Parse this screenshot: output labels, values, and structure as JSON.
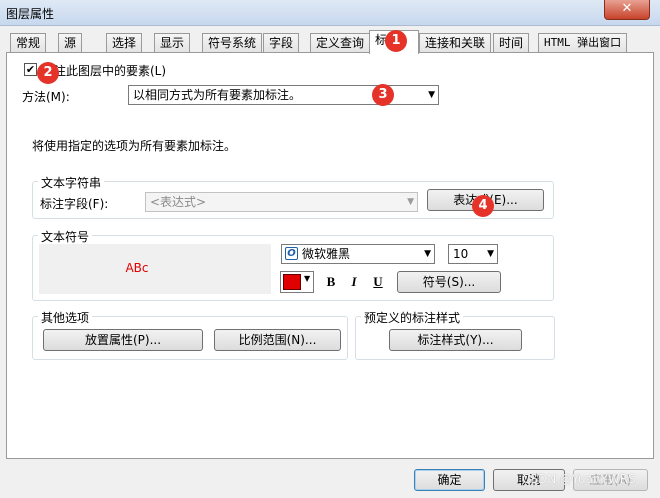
{
  "window": {
    "title": "图层属性",
    "close": "✕"
  },
  "tabs": [
    {
      "label": "常规"
    },
    {
      "label": "源"
    },
    {
      "label": "选择"
    },
    {
      "label": "显示"
    },
    {
      "label": "符号系统"
    },
    {
      "label": "字段"
    },
    {
      "label": "定义查询"
    },
    {
      "label": "标"
    },
    {
      "label": "连接和关联"
    },
    {
      "label": "时间"
    },
    {
      "label": "HTML 弹出窗口"
    }
  ],
  "label_tab": {
    "checkbox_label": "标注此图层中的要素(L)",
    "checkbox_checked": true,
    "method_label": "方法(M):",
    "method_value": "以相同方式为所有要素加标注。",
    "info_text": "将使用指定的选项为所有要素加标注。",
    "text_string_group": {
      "title": "文本字符串",
      "field_label": "标注字段(F):",
      "field_value": "<表达式>",
      "expression_button": "表达式(E)..."
    },
    "text_symbol_group": {
      "title": "文本符号",
      "preview_text": "ABc",
      "preview_color": "#e00000",
      "font_name": "微软雅黑",
      "font_size": "10",
      "color_swatch": "#e00000",
      "bold": "B",
      "italic": "I",
      "underline": "U",
      "symbol_button": "符号(S)..."
    },
    "other_options_group": {
      "title": "其他选项",
      "placement_button": "放置属性(P)...",
      "scale_button": "比例范围(N)..."
    },
    "predefined_group": {
      "title": "预定义的标注样式",
      "style_button": "标注样式(Y)..."
    }
  },
  "footer": {
    "ok": "确定",
    "cancel": "取消",
    "apply": "应用(A)",
    "watermark": "CSDN @YuanYWRS"
  },
  "badges": [
    "1",
    "2",
    "3",
    "4"
  ]
}
